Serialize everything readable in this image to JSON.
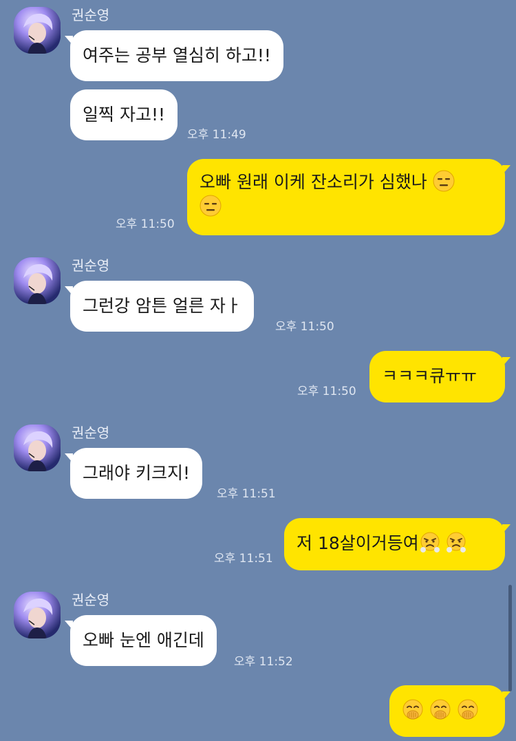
{
  "contact": {
    "name": "권순영"
  },
  "messages": [
    {
      "id": "m1",
      "direction": "in",
      "text": "여주는 공부 열심히 하고!!",
      "time": ""
    },
    {
      "id": "m2",
      "direction": "in",
      "text": "일찍 자고!!",
      "time": "오후 11:49"
    },
    {
      "id": "m3",
      "direction": "out",
      "text": "오빠 원래 이케 잔소리가 심했나",
      "emoji": "expressionless-face-icon",
      "time": "오후 11:50"
    },
    {
      "id": "m4",
      "direction": "in",
      "text": "그런강 암튼 얼른 자ㅏ",
      "time": "오후 11:50"
    },
    {
      "id": "m5",
      "direction": "out",
      "text": "ㅋㅋㅋ큐ㅠㅠ",
      "time": "오후 11:50"
    },
    {
      "id": "m6",
      "direction": "in",
      "text": "그래야 키크지!",
      "time": "오후 11:51"
    },
    {
      "id": "m7",
      "direction": "out",
      "text": "저 18살이거등여",
      "emoji": "face-with-steam-icon",
      "time": "오후 11:51"
    },
    {
      "id": "m8",
      "direction": "in",
      "text": "오빠 눈엔 애긴데",
      "time": "오후 11:52"
    },
    {
      "id": "m9",
      "direction": "out",
      "text": "",
      "emoji": "face-with-hand-over-mouth-icon",
      "time": ""
    }
  ],
  "colors": {
    "background": "#6b86ad",
    "incoming_bubble": "#ffffff",
    "outgoing_bubble": "#ffe400"
  }
}
